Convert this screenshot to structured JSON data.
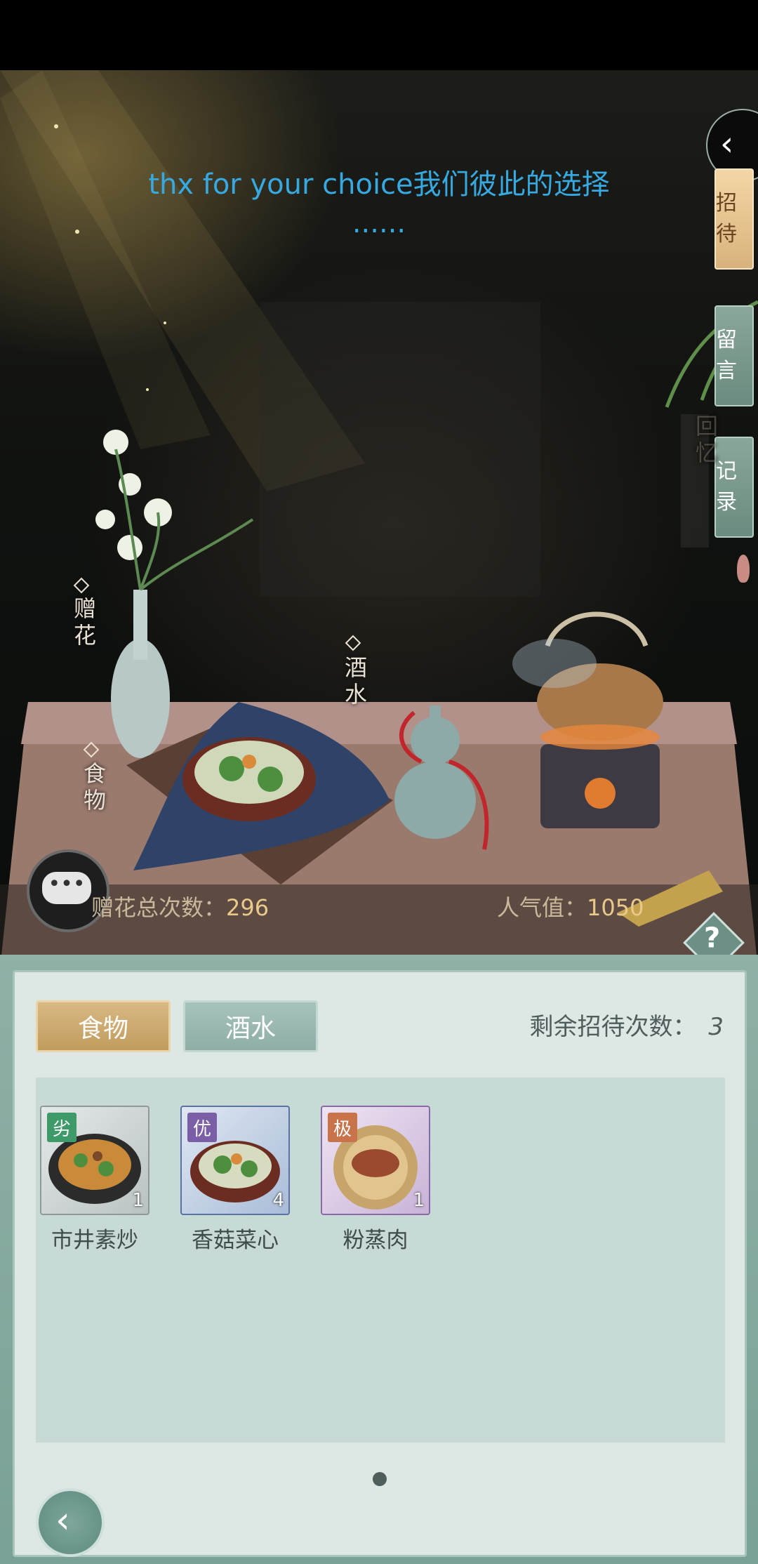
{
  "scene": {
    "caption_line1": "thx for your choice我们彼此的选择",
    "caption_line2": "......",
    "side_tabs": [
      {
        "label": "招待",
        "active": true
      },
      {
        "label": "留言",
        "active": false
      },
      {
        "label": "记录",
        "active": false
      }
    ],
    "faded_wall_text": "回忆",
    "labels": {
      "flower": "赠花",
      "food": "食物",
      "drink": "酒水"
    },
    "stats": {
      "flower_count_label": "赠花总次数：",
      "flower_count_value": "296",
      "popularity_label": "人气值：",
      "popularity_value": "1050"
    }
  },
  "panel": {
    "tabs": [
      {
        "label": "食物",
        "active": true
      },
      {
        "label": "酒水",
        "active": false
      }
    ],
    "remaining_label": "剩余招待次数：",
    "remaining_value": "3",
    "items": [
      {
        "name": "市井素炒",
        "quality": "劣",
        "quality_color": "#3f9a6a",
        "count": "1"
      },
      {
        "name": "香菇菜心",
        "quality": "优",
        "quality_color": "#7a5fa6",
        "count": "4"
      },
      {
        "name": "粉蒸肉",
        "quality": "极",
        "quality_color": "#c8734a",
        "count": "1"
      }
    ],
    "page_indicator": 1
  },
  "colors": {
    "caption": "#36a9e0",
    "tab_active": "#d8b27c",
    "tab_inactive": "#9dbab3",
    "panel_bg": "#dde8e5"
  }
}
